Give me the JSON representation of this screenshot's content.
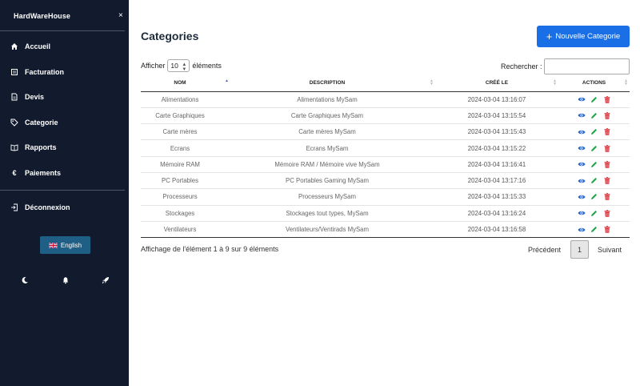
{
  "sidebar": {
    "brand": "HardWareHouse",
    "close": "×",
    "items": [
      {
        "label": "Accueil",
        "icon": "home-icon"
      },
      {
        "label": "Facturation",
        "icon": "invoice-icon"
      },
      {
        "label": "Devis",
        "icon": "document-icon"
      },
      {
        "label": "Categorie",
        "icon": "tag-icon"
      },
      {
        "label": "Rapports",
        "icon": "book-icon"
      },
      {
        "label": "Paiements",
        "icon": "euro-icon"
      }
    ],
    "logout": {
      "label": "Déconnexion",
      "icon": "logout-icon"
    },
    "language": {
      "label": "English",
      "icon": "uk-flag-icon"
    },
    "bottom_icons": [
      "moon-icon",
      "bell-icon",
      "rocket-icon"
    ]
  },
  "main": {
    "title": "Categories",
    "new_button": "Nouvelle Categorie",
    "show_prefix": "Afficher",
    "show_value": "10",
    "show_suffix": "éléments",
    "search_label": "Rechercher :",
    "search_value": "",
    "columns": [
      "Nom",
      "Description",
      "Créé le",
      "Actions"
    ],
    "rows": [
      {
        "name": "Alimentations",
        "description": "Alimentations MySam",
        "created": "2024-03-04 13:16:07"
      },
      {
        "name": "Carte Graphiques",
        "description": "Carte Graphiques MySam",
        "created": "2024-03-04 13:15:54"
      },
      {
        "name": "Carte mères",
        "description": "Carte mères MySam",
        "created": "2024-03-04 13:15:43"
      },
      {
        "name": "Ecrans",
        "description": "Ecrans MySam",
        "created": "2024-03-04 13:15:22"
      },
      {
        "name": "Mémoire RAM",
        "description": "Mémoire RAM / Mémoire vive MySam",
        "created": "2024-03-04 13:16:41"
      },
      {
        "name": "PC Portables",
        "description": "PC Portables Gaming MySam",
        "created": "2024-03-04 13:17:16"
      },
      {
        "name": "Processeurs",
        "description": "Processeurs MySam",
        "created": "2024-03-04 13:15:33"
      },
      {
        "name": "Stockages",
        "description": "Stockages tout types, MySam",
        "created": "2024-03-04 13:16:24"
      },
      {
        "name": "Ventilateurs",
        "description": "Ventilateurs/Ventirads MySam",
        "created": "2024-03-04 13:16:58"
      }
    ],
    "info": "Affichage de l'élément 1 à 9 sur 9 éléments",
    "pagination": {
      "prev": "Précédent",
      "current": "1",
      "next": "Suivant"
    }
  },
  "colors": {
    "sidebar_bg": "#121b2d",
    "primary": "#1a6ee6",
    "view": "#1f63c9",
    "edit": "#22a34a",
    "delete": "#d9343c"
  }
}
